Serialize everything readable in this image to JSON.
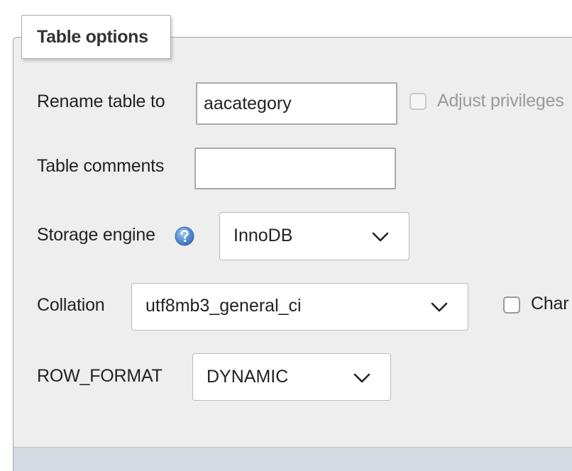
{
  "legend": "Table options",
  "rename": {
    "label": "Rename table to",
    "value": "aacategory",
    "adjust_privileges_label": "Adjust privileges",
    "adjust_privileges_checked": false,
    "adjust_privileges_disabled": true
  },
  "comments": {
    "label": "Table comments",
    "value": ""
  },
  "engine": {
    "label": "Storage engine",
    "help_icon": "help-icon",
    "selected": "InnoDB"
  },
  "collation": {
    "label": "Collation",
    "selected": "utf8mb3_general_ci",
    "change_all_label": "Char",
    "change_all_checked": false
  },
  "row_format": {
    "label": "ROW_FORMAT",
    "selected": "DYNAMIC"
  },
  "colors": {
    "panel_bg": "#eeeeee",
    "footer_bg": "#d3dce3",
    "help_icon": "#5b8fd6"
  }
}
